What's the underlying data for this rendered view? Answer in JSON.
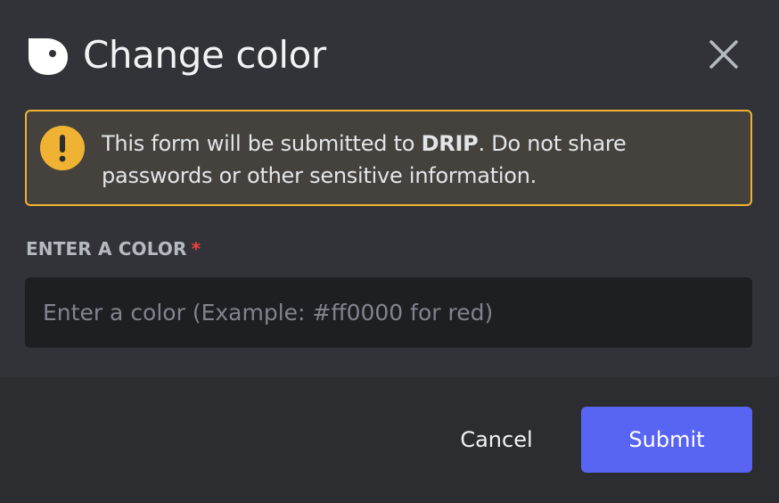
{
  "dialog": {
    "title": "Change color",
    "app_icon": "app-avatar-icon",
    "close_icon": "close-icon"
  },
  "warning": {
    "icon": "exclamation-icon",
    "text_before": "This form will be submitted to ",
    "app_name": "DRIP",
    "text_after": ". Do not share passwords or other sensitive information."
  },
  "field": {
    "label": "ENTER A COLOR",
    "required_marker": "*",
    "value": "",
    "placeholder": "Enter a color (Example: #ff0000 for red)"
  },
  "footer": {
    "cancel_label": "Cancel",
    "submit_label": "Submit"
  },
  "colors": {
    "background": "#313338",
    "footer_background": "#2b2d31",
    "input_background": "#1e1f22",
    "warning_border": "#f0b232",
    "warning_background": "#45423e",
    "primary_button": "#5865f2",
    "required": "#f23f43"
  }
}
